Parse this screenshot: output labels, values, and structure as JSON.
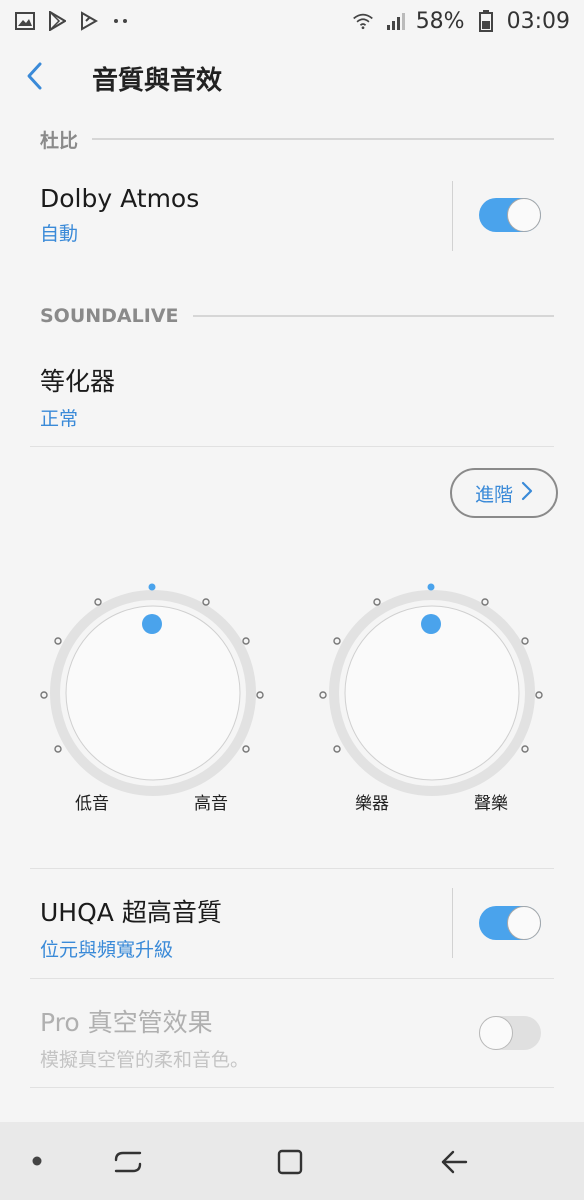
{
  "status_bar": {
    "left_icons": [
      "gallery-icon",
      "play-store-icon",
      "video-icon",
      "more-dots-icon"
    ],
    "battery_percent": "58%",
    "time": "03:09"
  },
  "header": {
    "title": "音質與音效"
  },
  "sections": {
    "dolby": "杜比",
    "soundalive": "SOUNDALIVE"
  },
  "dolby_atmos": {
    "title": "Dolby Atmos",
    "subtitle": "自動",
    "enabled": true
  },
  "equalizer": {
    "title": "等化器",
    "subtitle": "正常"
  },
  "advanced_button": {
    "label": "進階"
  },
  "dials": [
    {
      "left_label": "低音",
      "right_label": "高音",
      "level": 0
    },
    {
      "left_label": "樂器",
      "right_label": "聲樂",
      "level": 0
    }
  ],
  "uhqa": {
    "title": "UHQA 超高音質",
    "subtitle": "位元與頻寬升級",
    "enabled": true
  },
  "tube_amp": {
    "title": "Pro 真空管效果",
    "subtitle": "模擬真空管的柔和音色。",
    "enabled": false
  },
  "colors": {
    "accent": "#4aa3ec",
    "link_text": "#3a8ad8"
  },
  "nav_icons": [
    "dot-icon",
    "recents-icon",
    "home-icon",
    "back-icon"
  ]
}
